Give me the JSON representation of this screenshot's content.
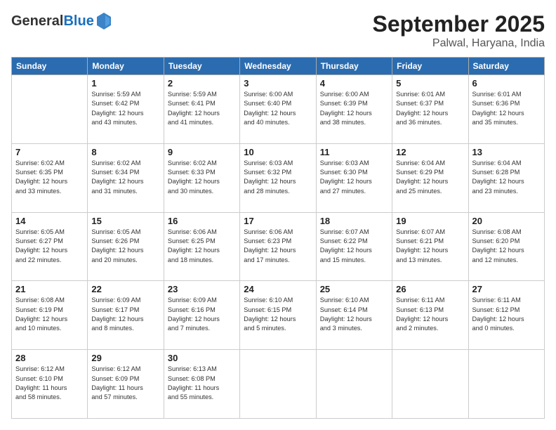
{
  "header": {
    "logo_general": "General",
    "logo_blue": "Blue",
    "month_title": "September 2025",
    "location": "Palwal, Haryana, India"
  },
  "weekdays": [
    "Sunday",
    "Monday",
    "Tuesday",
    "Wednesday",
    "Thursday",
    "Friday",
    "Saturday"
  ],
  "weeks": [
    [
      {
        "day": "",
        "info": ""
      },
      {
        "day": "1",
        "info": "Sunrise: 5:59 AM\nSunset: 6:42 PM\nDaylight: 12 hours\nand 43 minutes."
      },
      {
        "day": "2",
        "info": "Sunrise: 5:59 AM\nSunset: 6:41 PM\nDaylight: 12 hours\nand 41 minutes."
      },
      {
        "day": "3",
        "info": "Sunrise: 6:00 AM\nSunset: 6:40 PM\nDaylight: 12 hours\nand 40 minutes."
      },
      {
        "day": "4",
        "info": "Sunrise: 6:00 AM\nSunset: 6:39 PM\nDaylight: 12 hours\nand 38 minutes."
      },
      {
        "day": "5",
        "info": "Sunrise: 6:01 AM\nSunset: 6:37 PM\nDaylight: 12 hours\nand 36 minutes."
      },
      {
        "day": "6",
        "info": "Sunrise: 6:01 AM\nSunset: 6:36 PM\nDaylight: 12 hours\nand 35 minutes."
      }
    ],
    [
      {
        "day": "7",
        "info": "Sunrise: 6:02 AM\nSunset: 6:35 PM\nDaylight: 12 hours\nand 33 minutes."
      },
      {
        "day": "8",
        "info": "Sunrise: 6:02 AM\nSunset: 6:34 PM\nDaylight: 12 hours\nand 31 minutes."
      },
      {
        "day": "9",
        "info": "Sunrise: 6:02 AM\nSunset: 6:33 PM\nDaylight: 12 hours\nand 30 minutes."
      },
      {
        "day": "10",
        "info": "Sunrise: 6:03 AM\nSunset: 6:32 PM\nDaylight: 12 hours\nand 28 minutes."
      },
      {
        "day": "11",
        "info": "Sunrise: 6:03 AM\nSunset: 6:30 PM\nDaylight: 12 hours\nand 27 minutes."
      },
      {
        "day": "12",
        "info": "Sunrise: 6:04 AM\nSunset: 6:29 PM\nDaylight: 12 hours\nand 25 minutes."
      },
      {
        "day": "13",
        "info": "Sunrise: 6:04 AM\nSunset: 6:28 PM\nDaylight: 12 hours\nand 23 minutes."
      }
    ],
    [
      {
        "day": "14",
        "info": "Sunrise: 6:05 AM\nSunset: 6:27 PM\nDaylight: 12 hours\nand 22 minutes."
      },
      {
        "day": "15",
        "info": "Sunrise: 6:05 AM\nSunset: 6:26 PM\nDaylight: 12 hours\nand 20 minutes."
      },
      {
        "day": "16",
        "info": "Sunrise: 6:06 AM\nSunset: 6:25 PM\nDaylight: 12 hours\nand 18 minutes."
      },
      {
        "day": "17",
        "info": "Sunrise: 6:06 AM\nSunset: 6:23 PM\nDaylight: 12 hours\nand 17 minutes."
      },
      {
        "day": "18",
        "info": "Sunrise: 6:07 AM\nSunset: 6:22 PM\nDaylight: 12 hours\nand 15 minutes."
      },
      {
        "day": "19",
        "info": "Sunrise: 6:07 AM\nSunset: 6:21 PM\nDaylight: 12 hours\nand 13 minutes."
      },
      {
        "day": "20",
        "info": "Sunrise: 6:08 AM\nSunset: 6:20 PM\nDaylight: 12 hours\nand 12 minutes."
      }
    ],
    [
      {
        "day": "21",
        "info": "Sunrise: 6:08 AM\nSunset: 6:19 PM\nDaylight: 12 hours\nand 10 minutes."
      },
      {
        "day": "22",
        "info": "Sunrise: 6:09 AM\nSunset: 6:17 PM\nDaylight: 12 hours\nand 8 minutes."
      },
      {
        "day": "23",
        "info": "Sunrise: 6:09 AM\nSunset: 6:16 PM\nDaylight: 12 hours\nand 7 minutes."
      },
      {
        "day": "24",
        "info": "Sunrise: 6:10 AM\nSunset: 6:15 PM\nDaylight: 12 hours\nand 5 minutes."
      },
      {
        "day": "25",
        "info": "Sunrise: 6:10 AM\nSunset: 6:14 PM\nDaylight: 12 hours\nand 3 minutes."
      },
      {
        "day": "26",
        "info": "Sunrise: 6:11 AM\nSunset: 6:13 PM\nDaylight: 12 hours\nand 2 minutes."
      },
      {
        "day": "27",
        "info": "Sunrise: 6:11 AM\nSunset: 6:12 PM\nDaylight: 12 hours\nand 0 minutes."
      }
    ],
    [
      {
        "day": "28",
        "info": "Sunrise: 6:12 AM\nSunset: 6:10 PM\nDaylight: 11 hours\nand 58 minutes."
      },
      {
        "day": "29",
        "info": "Sunrise: 6:12 AM\nSunset: 6:09 PM\nDaylight: 11 hours\nand 57 minutes."
      },
      {
        "day": "30",
        "info": "Sunrise: 6:13 AM\nSunset: 6:08 PM\nDaylight: 11 hours\nand 55 minutes."
      },
      {
        "day": "",
        "info": ""
      },
      {
        "day": "",
        "info": ""
      },
      {
        "day": "",
        "info": ""
      },
      {
        "day": "",
        "info": ""
      }
    ]
  ]
}
